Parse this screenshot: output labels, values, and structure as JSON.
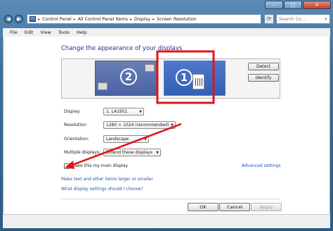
{
  "window": {
    "minimize_label": "–",
    "maximize_label": "□",
    "close_label": "✕",
    "icons": {
      "close": "close-icon",
      "back": "back-arrow-icon",
      "forward": "forward-arrow-icon",
      "refresh": "refresh-icon",
      "search": "search-icon"
    }
  },
  "address": {
    "breadcrumbs": [
      "Control Panel",
      "All Control Panel Items",
      "Display",
      "Screen Resolution"
    ],
    "search_placeholder": "Search Co..."
  },
  "menu": [
    "File",
    "Edit",
    "View",
    "Tools",
    "Help"
  ],
  "main": {
    "heading": "Change the appearance of your displays",
    "monitors": [
      {
        "number": "2"
      },
      {
        "number": "1"
      }
    ],
    "detect_label": "Detect",
    "identify_label": "Identify",
    "display_label": "Display:",
    "display_value": "1. LA1951",
    "resolution_label": "Resolution:",
    "resolution_value": "1280 × 1024 (recommended)",
    "orientation_label": "Orientation:",
    "orientation_value": "Landscape",
    "multiple_label": "Multiple displays:",
    "multiple_value": "Extend these displays",
    "main_display_label": "Make this my main display",
    "advanced_link": "Advanced settings",
    "text_size_link": "Make text and other items larger or smaller",
    "which_settings_link": "What display settings should I choose?"
  },
  "footer": {
    "ok_label": "OK",
    "cancel_label": "Cancel",
    "apply_label": "Apply"
  },
  "annotation": {
    "highlight_color": "#e0151b",
    "arrow_color": "#e0151b"
  }
}
